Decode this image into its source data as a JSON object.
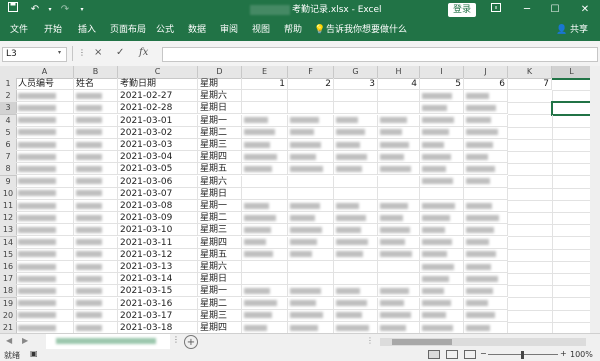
{
  "titlebar": {
    "filename": "考勤记录.xlsx",
    "separator": " - ",
    "app": "Excel",
    "login_label": "登录",
    "autosave_icon": "save-icon",
    "undo_icon": "undo-icon",
    "redo_icon": "redo-icon",
    "customize_icon": "dropdown-icon"
  },
  "ribbon": {
    "tabs": [
      "文件",
      "开始",
      "插入",
      "页面布局",
      "公式",
      "数据",
      "审阅",
      "视图",
      "帮助"
    ],
    "tell_me": "告诉我你想要做什么",
    "share": "共享"
  },
  "formula_bar": {
    "name_box": "L3",
    "cancel_icon": "×",
    "enter_icon": "✓",
    "fx_icon": "fx",
    "value": ""
  },
  "columns": [
    "A",
    "B",
    "C",
    "D",
    "E",
    "F",
    "G",
    "H",
    "I",
    "J",
    "K",
    "L"
  ],
  "header_row": {
    "a": "人员编号",
    "b": "姓名",
    "c": "考勤日期",
    "d": "星期",
    "e": "1",
    "f": "2",
    "g": "3",
    "h": "4",
    "i": "5",
    "j": "6",
    "k": "7"
  },
  "rows": [
    {
      "n": "2",
      "date": "2021-02-27",
      "weekday": "星期六"
    },
    {
      "n": "3",
      "date": "2021-02-28",
      "weekday": "星期日"
    },
    {
      "n": "4",
      "date": "2021-03-01",
      "weekday": "星期一"
    },
    {
      "n": "5",
      "date": "2021-03-02",
      "weekday": "星期二"
    },
    {
      "n": "6",
      "date": "2021-03-03",
      "weekday": "星期三"
    },
    {
      "n": "7",
      "date": "2021-03-04",
      "weekday": "星期四"
    },
    {
      "n": "8",
      "date": "2021-03-05",
      "weekday": "星期五"
    },
    {
      "n": "9",
      "date": "2021-03-06",
      "weekday": "星期六"
    },
    {
      "n": "10",
      "date": "2021-03-07",
      "weekday": "星期日"
    },
    {
      "n": "11",
      "date": "2021-03-08",
      "weekday": "星期一"
    },
    {
      "n": "12",
      "date": "2021-03-09",
      "weekday": "星期二"
    },
    {
      "n": "13",
      "date": "2021-03-10",
      "weekday": "星期三"
    },
    {
      "n": "14",
      "date": "2021-03-11",
      "weekday": "星期四"
    },
    {
      "n": "15",
      "date": "2021-03-12",
      "weekday": "星期五"
    },
    {
      "n": "16",
      "date": "2021-03-13",
      "weekday": "星期六"
    },
    {
      "n": "17",
      "date": "2021-03-14",
      "weekday": "星期日"
    },
    {
      "n": "18",
      "date": "2021-03-15",
      "weekday": "星期一"
    },
    {
      "n": "19",
      "date": "2021-03-16",
      "weekday": "星期二"
    },
    {
      "n": "20",
      "date": "2021-03-17",
      "weekday": "星期三"
    },
    {
      "n": "21",
      "date": "2021-03-18",
      "weekday": "星期四"
    }
  ],
  "row1_label": "1",
  "status": {
    "ready": "就绪",
    "zoom": "100%",
    "zoom_out": "−",
    "zoom_in": "+"
  },
  "accent_color": "#217346"
}
